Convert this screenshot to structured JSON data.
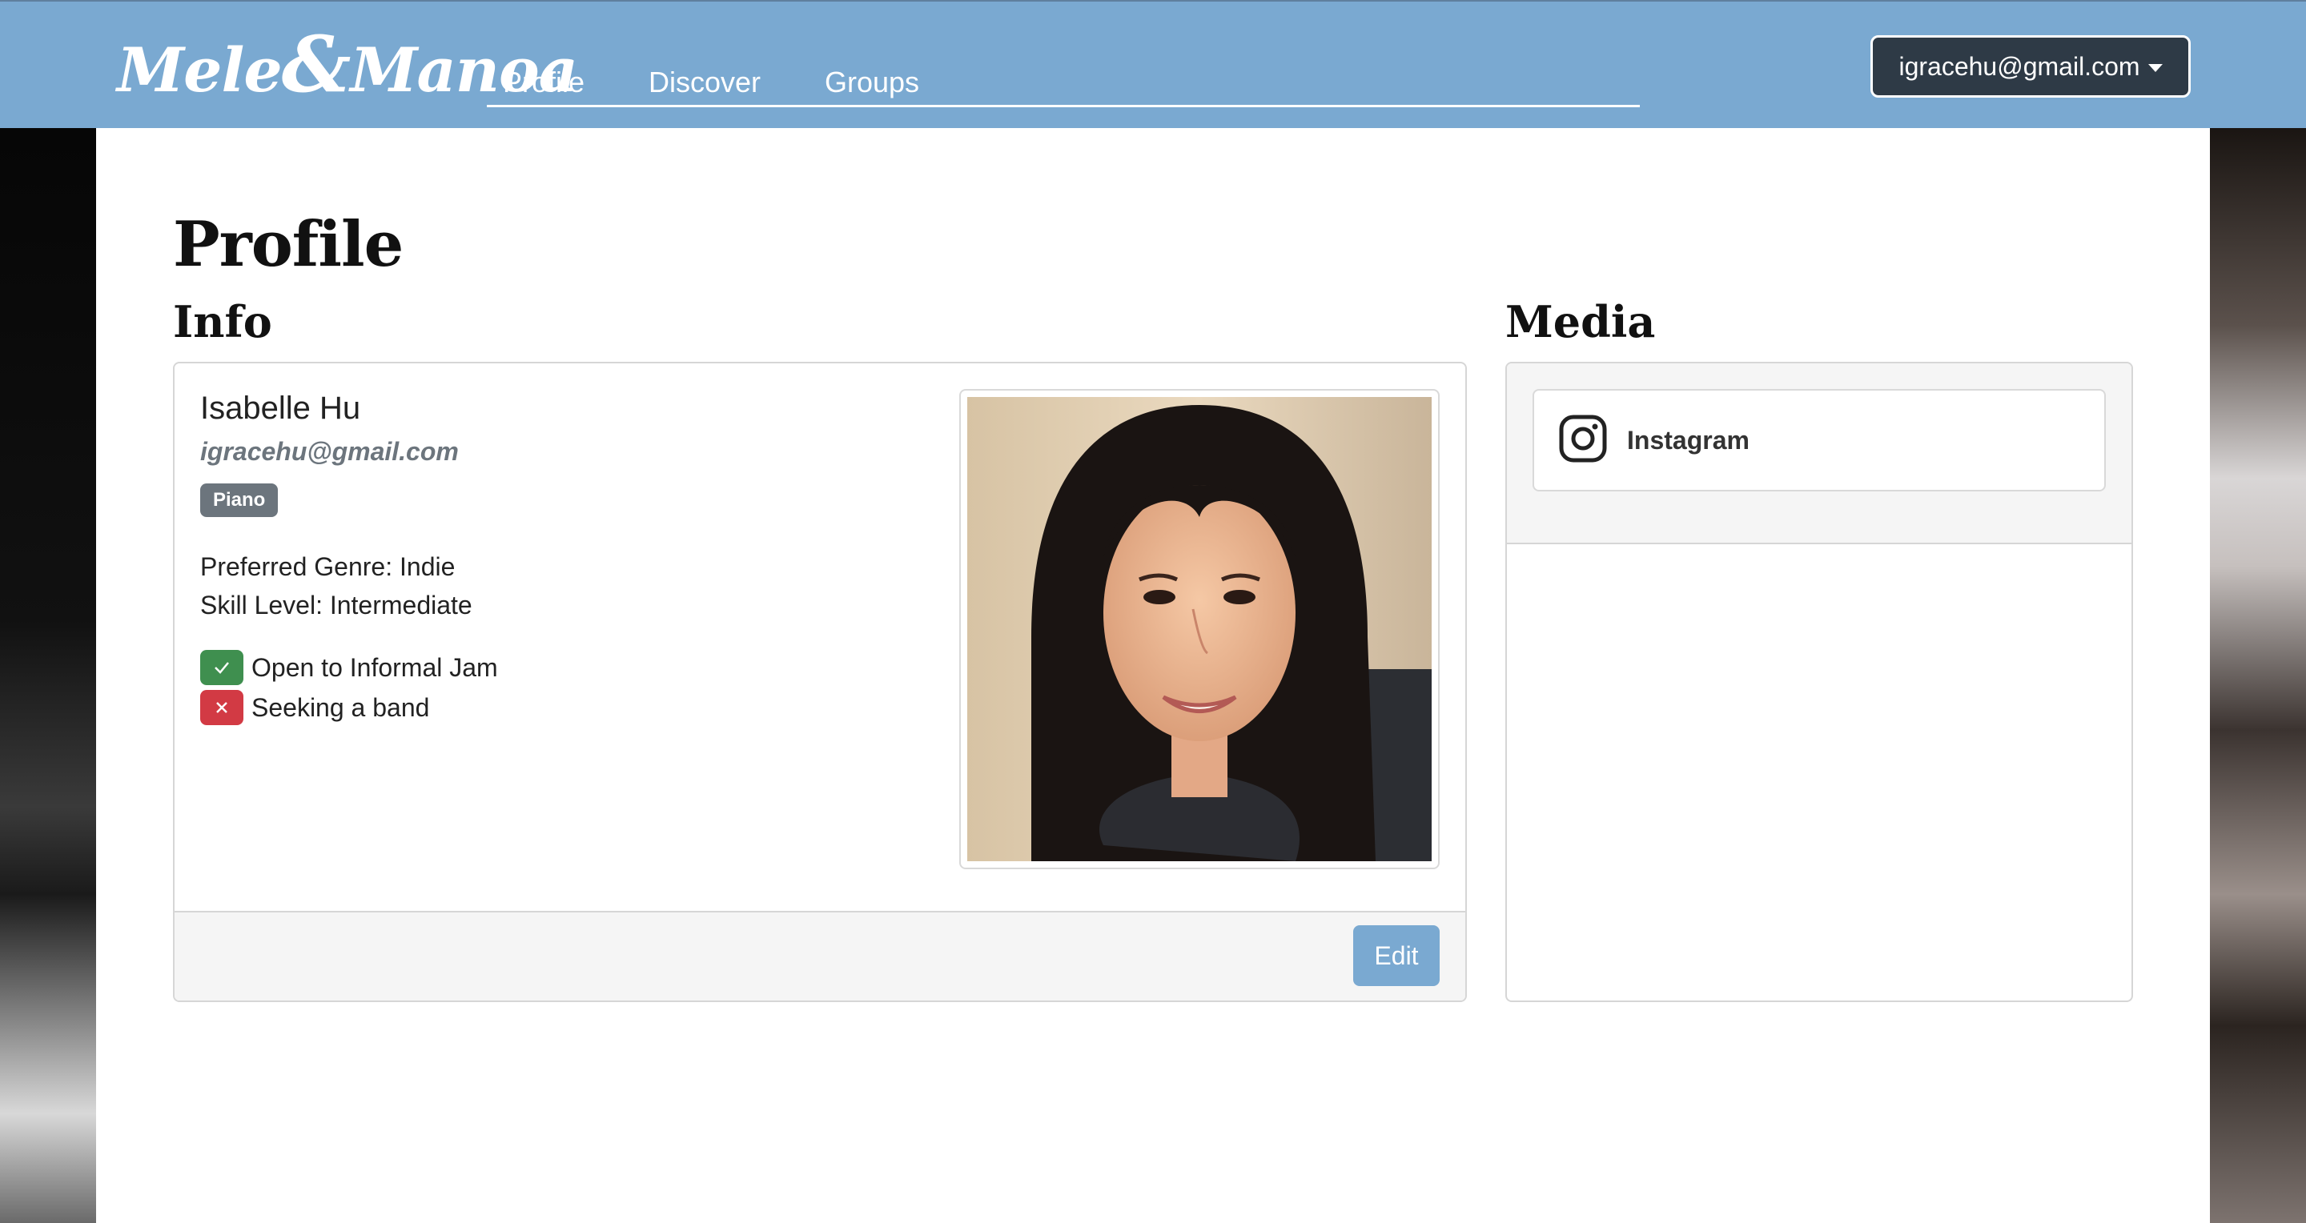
{
  "brand": {
    "logo_left": "Mele",
    "logo_amp": "&",
    "logo_right": "Manoa"
  },
  "nav": {
    "items": [
      {
        "label": "Profile"
      },
      {
        "label": "Discover"
      },
      {
        "label": "Groups"
      }
    ]
  },
  "user_menu": {
    "email": "igracehu@gmail.com"
  },
  "page": {
    "title": "Profile"
  },
  "info": {
    "heading": "Info",
    "name": "Isabelle Hu",
    "email": "igracehu@gmail.com",
    "instrument_badge": "Piano",
    "preferred_genre": "Preferred Genre: Indie",
    "skill_level": "Skill Level: Intermediate",
    "flags": [
      {
        "label": "Open to Informal Jam",
        "state": "yes"
      },
      {
        "label": "Seeking a band",
        "state": "no"
      }
    ],
    "edit_label": "Edit"
  },
  "media": {
    "heading": "Media",
    "links": [
      {
        "label": "Instagram",
        "icon": "instagram-icon"
      }
    ]
  },
  "colors": {
    "navbar": "#7aa9d1",
    "dropdown": "#2e3a46",
    "badge": "#6c757d",
    "yes": "#3f8f4f",
    "no": "#d23a44"
  }
}
